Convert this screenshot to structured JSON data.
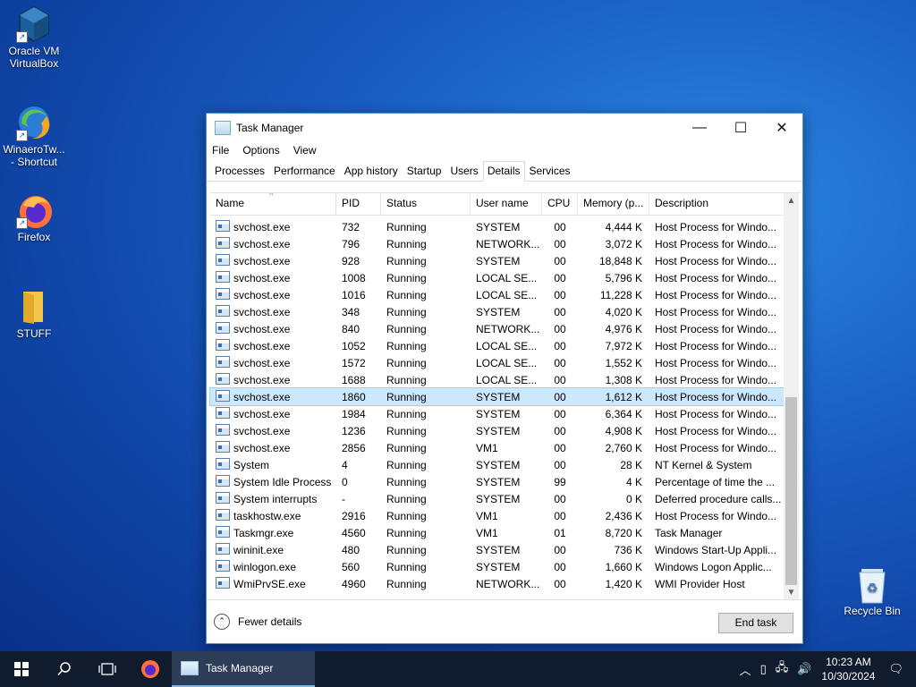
{
  "desktop": {
    "icons": [
      {
        "label": "Oracle VM VirtualBox"
      },
      {
        "label": "WinaeroTw... - Shortcut"
      },
      {
        "label": "Firefox"
      },
      {
        "label": "STUFF"
      },
      {
        "label": "Recycle Bin"
      }
    ]
  },
  "task_manager": {
    "title": "Task Manager",
    "menu": [
      "File",
      "Options",
      "View"
    ],
    "tabs": [
      "Processes",
      "Performance",
      "App history",
      "Startup",
      "Users",
      "Details",
      "Services"
    ],
    "active_tab": "Details",
    "columns": {
      "name": "Name",
      "pid": "PID",
      "status": "Status",
      "user": "User name",
      "cpu": "CPU",
      "memory": "Memory (p...",
      "description": "Description"
    },
    "rows": [
      {
        "name": "svchost.exe",
        "pid": "732",
        "status": "Running",
        "user": "SYSTEM",
        "cpu": "00",
        "memory": "4,444 K",
        "description": "Host Process for Windo..."
      },
      {
        "name": "svchost.exe",
        "pid": "796",
        "status": "Running",
        "user": "NETWORK...",
        "cpu": "00",
        "memory": "3,072 K",
        "description": "Host Process for Windo..."
      },
      {
        "name": "svchost.exe",
        "pid": "928",
        "status": "Running",
        "user": "SYSTEM",
        "cpu": "00",
        "memory": "18,848 K",
        "description": "Host Process for Windo..."
      },
      {
        "name": "svchost.exe",
        "pid": "1008",
        "status": "Running",
        "user": "LOCAL SE...",
        "cpu": "00",
        "memory": "5,796 K",
        "description": "Host Process for Windo..."
      },
      {
        "name": "svchost.exe",
        "pid": "1016",
        "status": "Running",
        "user": "LOCAL SE...",
        "cpu": "00",
        "memory": "11,228 K",
        "description": "Host Process for Windo..."
      },
      {
        "name": "svchost.exe",
        "pid": "348",
        "status": "Running",
        "user": "SYSTEM",
        "cpu": "00",
        "memory": "4,020 K",
        "description": "Host Process for Windo..."
      },
      {
        "name": "svchost.exe",
        "pid": "840",
        "status": "Running",
        "user": "NETWORK...",
        "cpu": "00",
        "memory": "4,976 K",
        "description": "Host Process for Windo..."
      },
      {
        "name": "svchost.exe",
        "pid": "1052",
        "status": "Running",
        "user": "LOCAL SE...",
        "cpu": "00",
        "memory": "7,972 K",
        "description": "Host Process for Windo..."
      },
      {
        "name": "svchost.exe",
        "pid": "1572",
        "status": "Running",
        "user": "LOCAL SE...",
        "cpu": "00",
        "memory": "1,552 K",
        "description": "Host Process for Windo..."
      },
      {
        "name": "svchost.exe",
        "pid": "1688",
        "status": "Running",
        "user": "LOCAL SE...",
        "cpu": "00",
        "memory": "1,308 K",
        "description": "Host Process for Windo..."
      },
      {
        "name": "svchost.exe",
        "pid": "1860",
        "status": "Running",
        "user": "SYSTEM",
        "cpu": "00",
        "memory": "1,612 K",
        "description": "Host Process for Windo...",
        "selected": true
      },
      {
        "name": "svchost.exe",
        "pid": "1984",
        "status": "Running",
        "user": "SYSTEM",
        "cpu": "00",
        "memory": "6,364 K",
        "description": "Host Process for Windo..."
      },
      {
        "name": "svchost.exe",
        "pid": "1236",
        "status": "Running",
        "user": "SYSTEM",
        "cpu": "00",
        "memory": "4,908 K",
        "description": "Host Process for Windo..."
      },
      {
        "name": "svchost.exe",
        "pid": "2856",
        "status": "Running",
        "user": "VM1",
        "cpu": "00",
        "memory": "2,760 K",
        "description": "Host Process for Windo..."
      },
      {
        "name": "System",
        "pid": "4",
        "status": "Running",
        "user": "SYSTEM",
        "cpu": "00",
        "memory": "28 K",
        "description": "NT Kernel & System"
      },
      {
        "name": "System Idle Process",
        "pid": "0",
        "status": "Running",
        "user": "SYSTEM",
        "cpu": "99",
        "memory": "4 K",
        "description": "Percentage of time the ..."
      },
      {
        "name": "System interrupts",
        "pid": "-",
        "status": "Running",
        "user": "SYSTEM",
        "cpu": "00",
        "memory": "0 K",
        "description": "Deferred procedure calls..."
      },
      {
        "name": "taskhostw.exe",
        "pid": "2916",
        "status": "Running",
        "user": "VM1",
        "cpu": "00",
        "memory": "2,436 K",
        "description": "Host Process for Windo..."
      },
      {
        "name": "Taskmgr.exe",
        "pid": "4560",
        "status": "Running",
        "user": "VM1",
        "cpu": "01",
        "memory": "8,720 K",
        "description": "Task Manager"
      },
      {
        "name": "wininit.exe",
        "pid": "480",
        "status": "Running",
        "user": "SYSTEM",
        "cpu": "00",
        "memory": "736 K",
        "description": "Windows Start-Up Appli..."
      },
      {
        "name": "winlogon.exe",
        "pid": "560",
        "status": "Running",
        "user": "SYSTEM",
        "cpu": "00",
        "memory": "1,660 K",
        "description": "Windows Logon Applic..."
      },
      {
        "name": "WmiPrvSE.exe",
        "pid": "4960",
        "status": "Running",
        "user": "NETWORK...",
        "cpu": "00",
        "memory": "1,420 K",
        "description": "WMI Provider Host"
      }
    ],
    "footer": {
      "fewer_details": "Fewer details",
      "end_task": "End task"
    }
  },
  "taskbar": {
    "app_label": "Task Manager",
    "time": "10:23 AM",
    "date": "10/30/2024"
  },
  "colors": {
    "selection": "#cce8ff",
    "taskbar": "#101b2d",
    "accent": "#76b9ed"
  }
}
